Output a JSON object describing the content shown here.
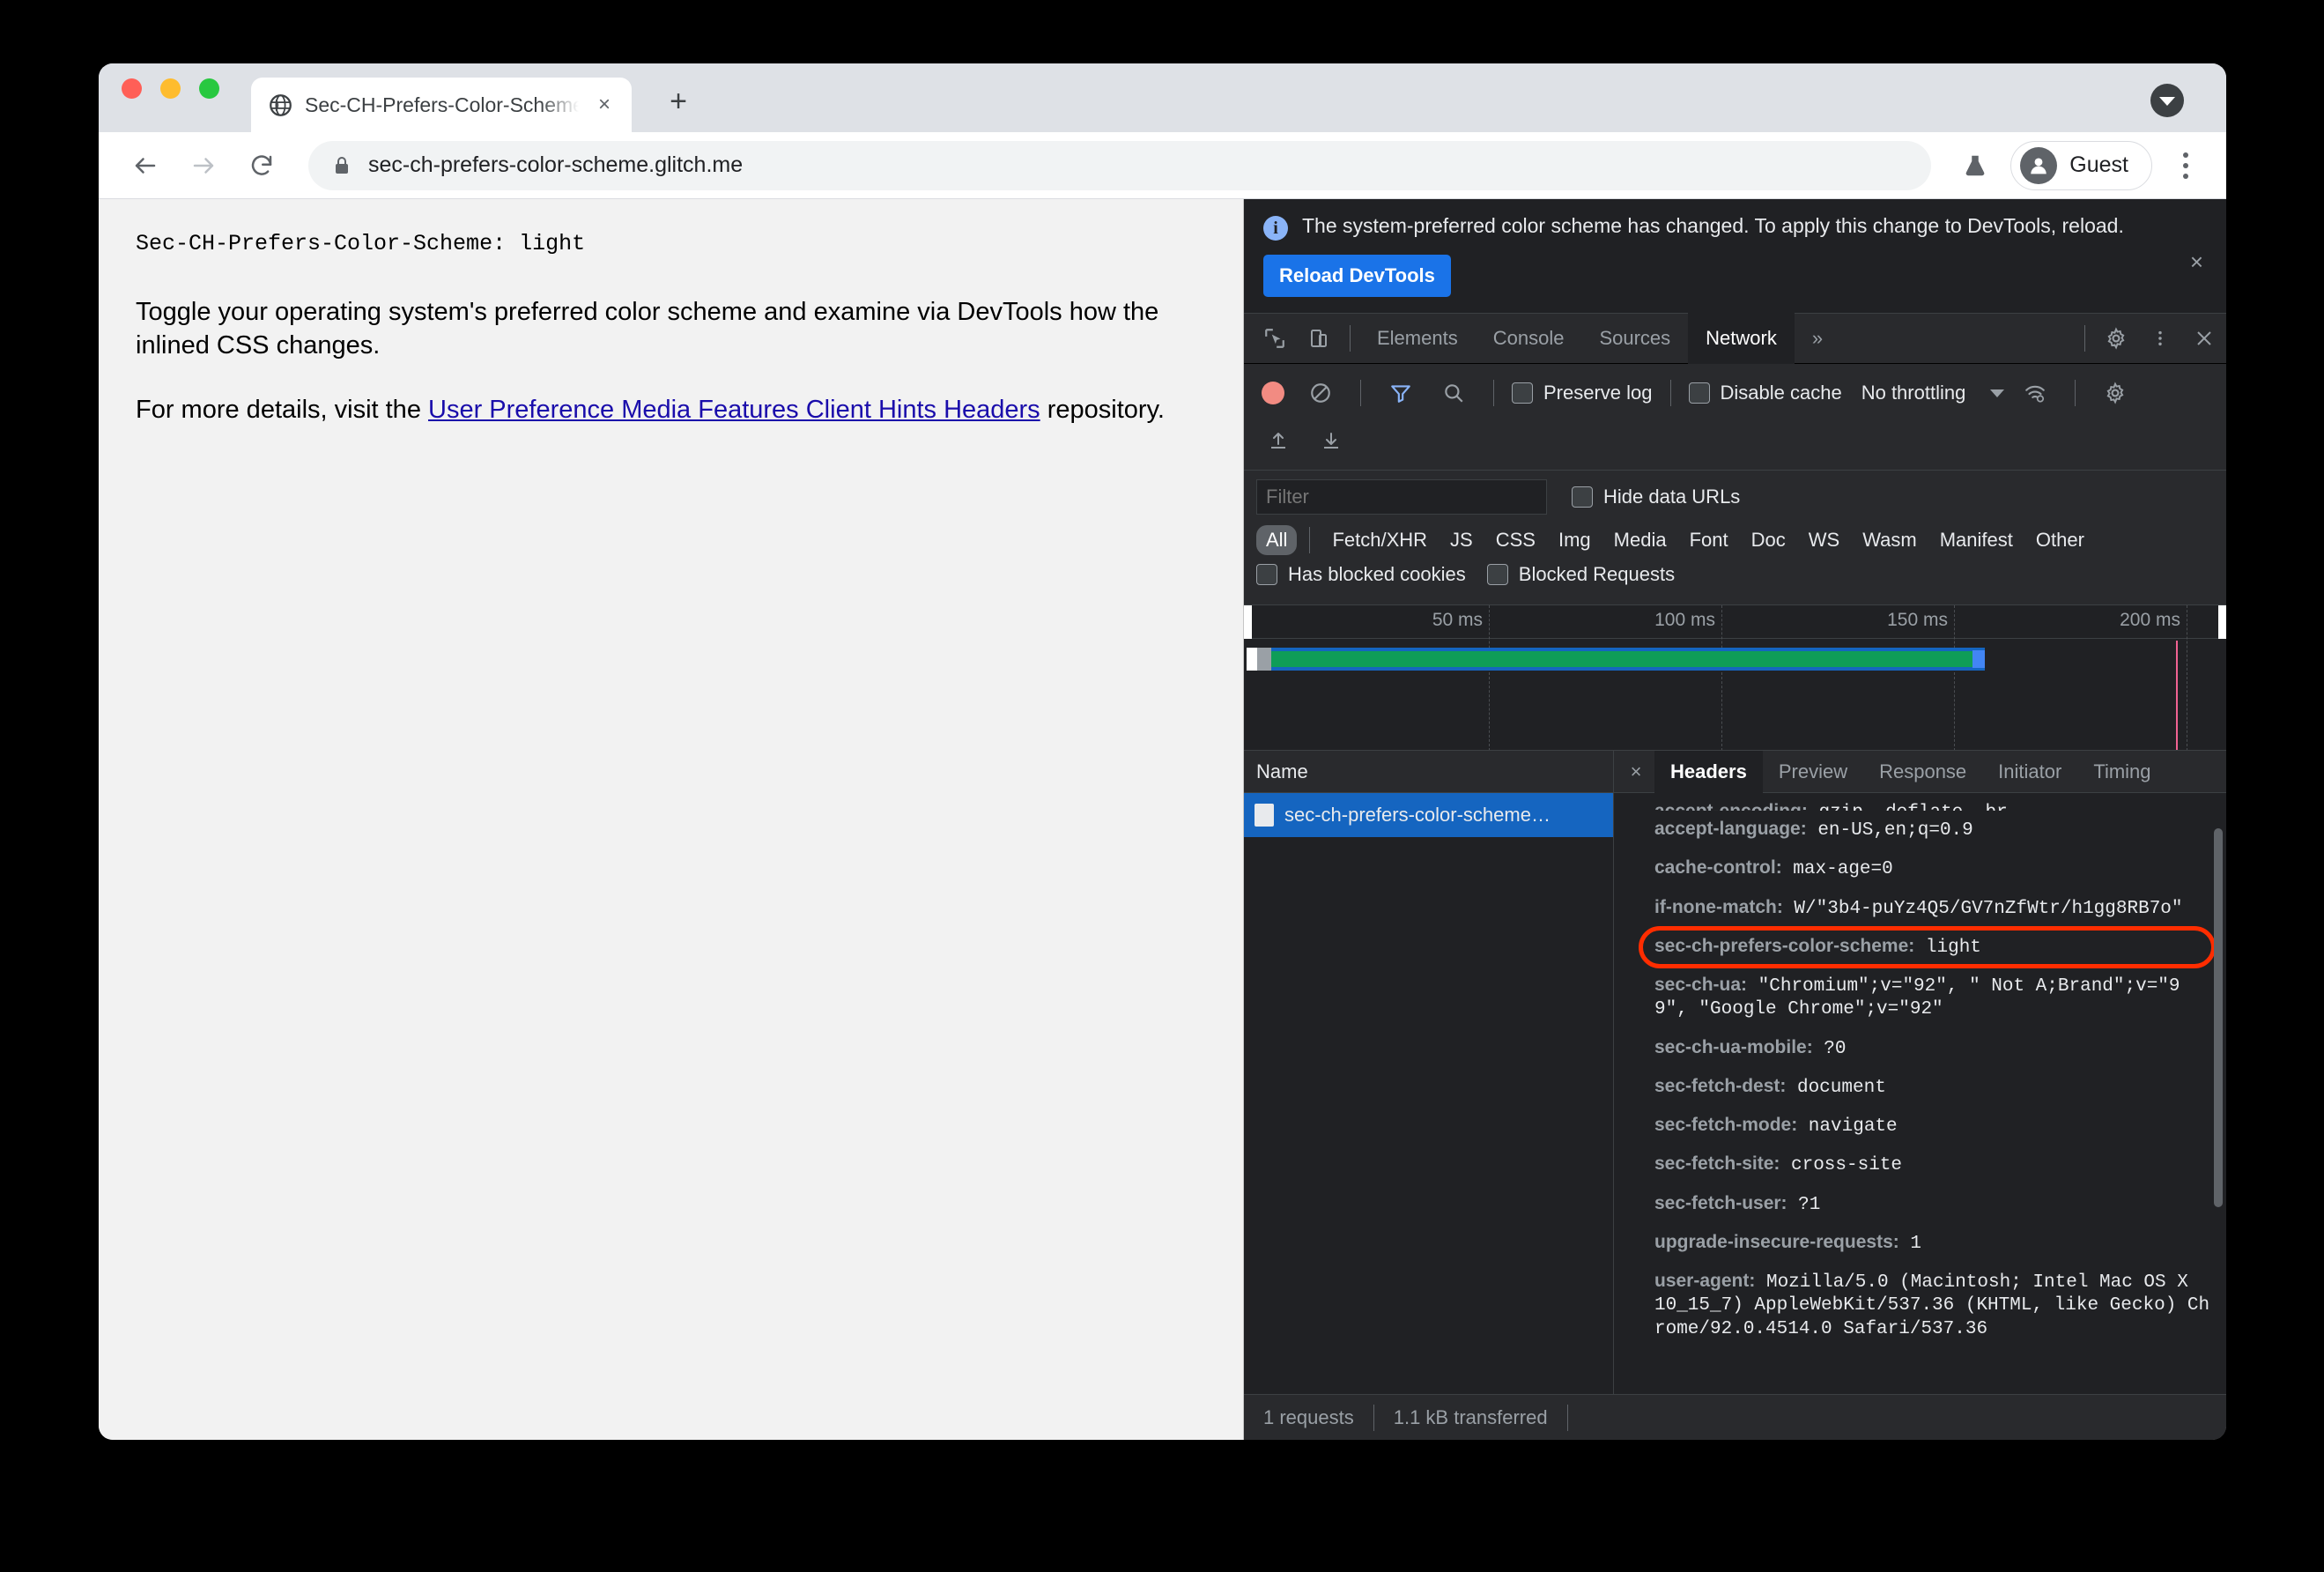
{
  "browser": {
    "tab": {
      "title": "Sec-CH-Prefers-Color-Scheme",
      "favicon": "globe-icon",
      "close": "×"
    },
    "new_tab_label": "+",
    "tab_search_icon": "chevron-down-icon",
    "omnibox": {
      "url": "sec-ch-prefers-color-scheme.glitch.me",
      "lock": "lock-icon"
    },
    "nav": {
      "back": "back-arrow-icon",
      "forward": "forward-arrow-icon",
      "reload": "reload-icon"
    },
    "experiments_icon": "flask-icon",
    "profile": {
      "name": "Guest",
      "avatar": "person-icon"
    },
    "menu_icon": "kebab-menu-icon"
  },
  "page": {
    "header_line": "Sec-CH-Prefers-Color-Scheme: light",
    "paragraph1": "Toggle your operating system's preferred color scheme and examine via DevTools how the inlined CSS changes.",
    "paragraph2_before": "For more details, visit the ",
    "link_text": "User Preference Media Features Client Hints Headers",
    "paragraph2_after": " repository."
  },
  "devtools": {
    "banner": {
      "message": "The system-preferred color scheme has changed. To apply this change to DevTools, reload.",
      "button": "Reload DevTools",
      "close": "×",
      "info_icon": "info-icon"
    },
    "tabs": [
      {
        "label": "Elements",
        "active": false
      },
      {
        "label": "Console",
        "active": false
      },
      {
        "label": "Sources",
        "active": false
      },
      {
        "label": "Network",
        "active": true
      }
    ],
    "more_tabs": "»",
    "inspect_icon": "inspect-cursor-icon",
    "device_icon": "device-toolbar-icon",
    "settings_icon": "gear-icon",
    "dots_icon": "kebab-menu-icon",
    "close_icon": "close-icon",
    "toolbar": {
      "record_icon": "record-icon",
      "clear_icon": "clear-icon",
      "filter_icon": "funnel-icon",
      "search_icon": "search-icon",
      "preserve_log": "Preserve log",
      "disable_cache": "Disable cache",
      "throttling": "No throttling",
      "wifi_icon": "network-conditions-icon",
      "settings_icon": "gear-icon",
      "import_icon": "import-har-icon",
      "export_icon": "export-har-icon"
    },
    "filter": {
      "placeholder": "Filter",
      "value": "",
      "hide_data_urls": "Hide data URLs",
      "types": [
        "All",
        "Fetch/XHR",
        "JS",
        "CSS",
        "Img",
        "Media",
        "Font",
        "Doc",
        "WS",
        "Wasm",
        "Manifest",
        "Other"
      ],
      "active_type": "All",
      "has_blocked_cookies": "Has blocked cookies",
      "blocked_requests": "Blocked Requests"
    },
    "overview": {
      "ticks": [
        "50 ms",
        "100 ms",
        "150 ms",
        "200 ms"
      ]
    },
    "requests": {
      "column_name": "Name",
      "rows": [
        {
          "name": "sec-ch-prefers-color-scheme…",
          "selected": true,
          "icon": "document-icon"
        }
      ]
    },
    "detail_tabs": [
      {
        "label": "Headers",
        "active": true
      },
      {
        "label": "Preview",
        "active": false
      },
      {
        "label": "Response",
        "active": false
      },
      {
        "label": "Initiator",
        "active": false
      },
      {
        "label": "Timing",
        "active": false
      }
    ],
    "detail_close": "×",
    "headers": [
      {
        "name": "accept-encoding:",
        "value": " gzip, deflate, br",
        "clipped": true,
        "highlight": false
      },
      {
        "name": "accept-language:",
        "value": " en-US,en;q=0.9",
        "clipped": false,
        "highlight": false
      },
      {
        "name": "cache-control:",
        "value": " max-age=0",
        "clipped": false,
        "highlight": false
      },
      {
        "name": "if-none-match:",
        "value": " W/\"3b4-puYz4Q5/GV7nZfWtr/h1gg8RB7o\"",
        "clipped": false,
        "highlight": false
      },
      {
        "name": "sec-ch-prefers-color-scheme:",
        "value": " light",
        "clipped": false,
        "highlight": true
      },
      {
        "name": "sec-ch-ua:",
        "value": " \"Chromium\";v=\"92\", \" Not A;Brand\";v=\"99\", \"Google Chrome\";v=\"92\"",
        "clipped": false,
        "highlight": false
      },
      {
        "name": "sec-ch-ua-mobile:",
        "value": " ?0",
        "clipped": false,
        "highlight": false
      },
      {
        "name": "sec-fetch-dest:",
        "value": " document",
        "clipped": false,
        "highlight": false
      },
      {
        "name": "sec-fetch-mode:",
        "value": " navigate",
        "clipped": false,
        "highlight": false
      },
      {
        "name": "sec-fetch-site:",
        "value": " cross-site",
        "clipped": false,
        "highlight": false
      },
      {
        "name": "sec-fetch-user:",
        "value": " ?1",
        "clipped": false,
        "highlight": false
      },
      {
        "name": "upgrade-insecure-requests:",
        "value": " 1",
        "clipped": false,
        "highlight": false
      },
      {
        "name": "user-agent:",
        "value": " Mozilla/5.0 (Macintosh; Intel Mac OS X 10_15_7) AppleWebKit/537.36 (KHTML, like Gecko) Chrome/92.0.4514.0 Safari/537.36",
        "clipped": false,
        "highlight": false
      }
    ],
    "status": {
      "requests": "1 requests",
      "transferred": "1.1 kB transferred"
    }
  },
  "colors": {
    "highlight_ring": "#ff2d00",
    "accent_blue": "#1a73e8",
    "selected_row": "#1565c0",
    "timeline_green": "#0f9d58",
    "dcl_pink": "#f06292"
  }
}
